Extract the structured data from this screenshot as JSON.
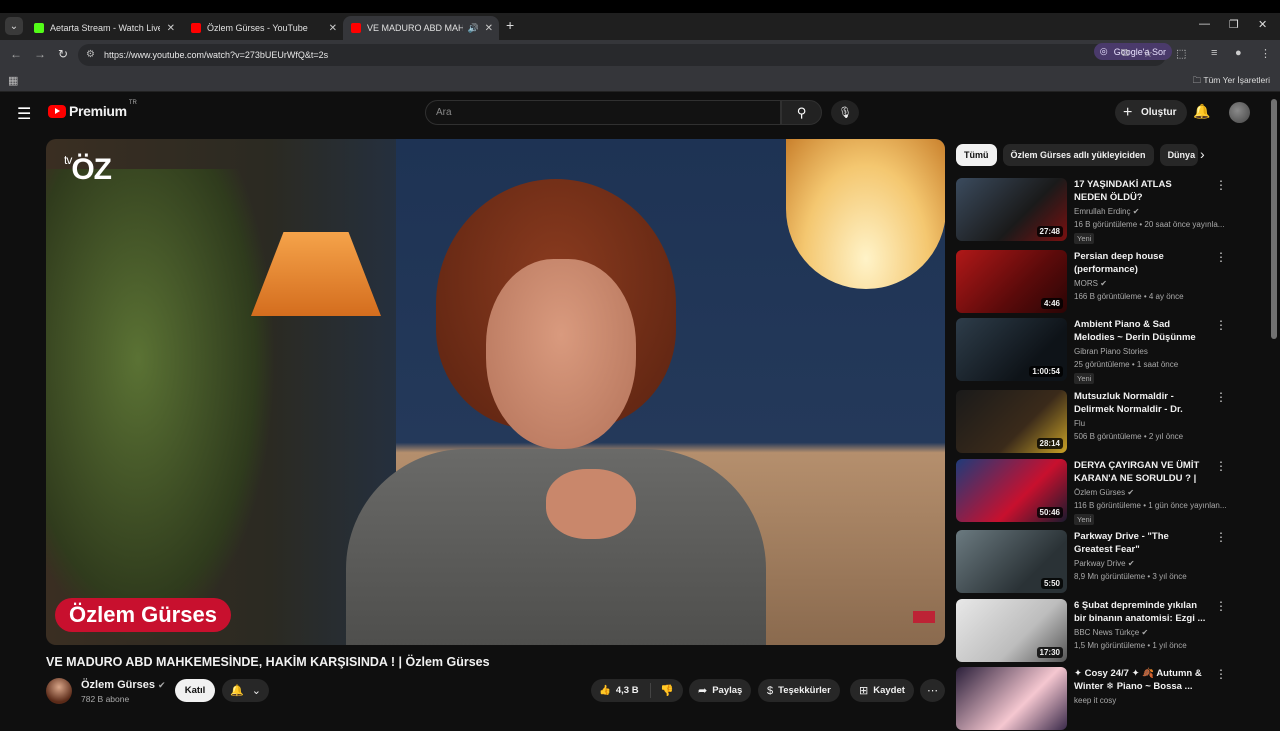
{
  "browser": {
    "tabs": [
      {
        "label": "Aetarta Stream - Watch Live on",
        "favicon_color": "#53fc18"
      },
      {
        "label": "Özlem Gürses - YouTube",
        "favicon_color": "#ff0000"
      },
      {
        "label": "VE MADURO ABD MAHKEMES",
        "favicon_color": "#ff0000"
      }
    ],
    "url": "https://www.youtube.com/watch?v=273bUEUrWfQ&t=2s",
    "ask_google": "Google'a Sor",
    "bookmarks_all": "Tüm Yer İşaretleri"
  },
  "youtube": {
    "logo_text": "Premium",
    "logo_region": "TR",
    "search_placeholder": "Ara",
    "create_label": "Oluştur"
  },
  "player": {
    "channel_brand": "ÖZ",
    "brand_prefix": "tv",
    "nameplate": "Özlem Gürses"
  },
  "video": {
    "title": "VE MADURO ABD MAHKEMESİNDE, HAKİM KARŞISINDA ! | Özlem Gürses",
    "channel": "Özlem Gürses",
    "subscribers": "782 B abone",
    "join_label": "Katıl",
    "likes": "4,3 B",
    "share_label": "Paylaş",
    "thanks_label": "Teşekkürler",
    "save_label": "Kaydet"
  },
  "sidebar": {
    "chips": [
      "Tümü",
      "Özlem Gürses adlı yükleyiciden",
      "Dünya"
    ],
    "items": [
      {
        "title": "17 YAŞINDAKİ ATLAS NEDEN ÖLDÜ?",
        "channel": "Emrullah Erdinç",
        "verified": true,
        "meta": "16 B görüntüleme • 20 saat önce yayınla...",
        "badge": "Yeni",
        "duration": "27:48",
        "thumb": "linear-gradient(135deg,#3b4b5e,#1a1a1a 60%,#7a1010)"
      },
      {
        "title": "Persian deep house (performance)",
        "channel": "MORS",
        "verified": true,
        "meta": "166 B görüntüleme • 4 ay önce",
        "badge": "",
        "duration": "4:46",
        "thumb": "linear-gradient(135deg,#b01818,#5a0a0a 60%,#2a0505)"
      },
      {
        "title": "Ambient Piano & Sad Melodies ~ Derin Düşünme ve Odaklan...",
        "channel": "Gibran Piano Stories",
        "verified": false,
        "meta": "25 görüntüleme • 1 saat önce",
        "badge": "Yeni",
        "duration": "1:00:54",
        "thumb": "linear-gradient(135deg,#2e3d4a,#0e1318 70%)"
      },
      {
        "title": "Mutsuzluk Normaldir - Delirmek Normaldir - Dr. Alper Hasanoğl...",
        "channel": "Flu",
        "verified": false,
        "meta": "506 B görüntüleme • 2 yıl önce",
        "badge": "",
        "duration": "28:14",
        "thumb": "linear-gradient(135deg,#1a1a1a,#3a2a1a 60%,#c9a227)"
      },
      {
        "title": "DERYA ÇAYIRGAN VE ÜMİT KARAN'A NE SORULDU ? | ...",
        "channel": "Özlem Gürses",
        "verified": true,
        "meta": "116 B görüntüleme • 1 gün önce yayınlan...",
        "badge": "Yeni",
        "duration": "50:46",
        "thumb": "linear-gradient(135deg,#1f3b7a,#c8102e 60%,#1a1a2e)"
      },
      {
        "title": "Parkway Drive - \"The Greatest Fear\"",
        "channel": "Parkway Drive",
        "verified": true,
        "meta": "8,9 Mn görüntüleme • 3 yıl önce",
        "badge": "",
        "duration": "5:50",
        "thumb": "linear-gradient(135deg,#6b7a80,#2a3236 70%)"
      },
      {
        "title": "6 Şubat depreminde yıkılan bir binanın anatomisi: Ezgi ...",
        "channel": "BBC News Türkçe",
        "verified": true,
        "meta": "1,5 Mn görüntüleme • 1 yıl önce",
        "badge": "",
        "duration": "17:30",
        "thumb": "linear-gradient(135deg,#e8e8e8,#bdbdbd 60%,#555)"
      },
      {
        "title": "✦ Cosy 24/7 ✦ 🍂 Autumn & Winter ❄ Piano ~ Bossa ...",
        "channel": "keep it cosy",
        "verified": false,
        "meta": "",
        "badge": "",
        "duration": "",
        "thumb": "linear-gradient(135deg,#2a1f3a,#f5c7d0 60%,#3a2a4a)"
      }
    ]
  }
}
